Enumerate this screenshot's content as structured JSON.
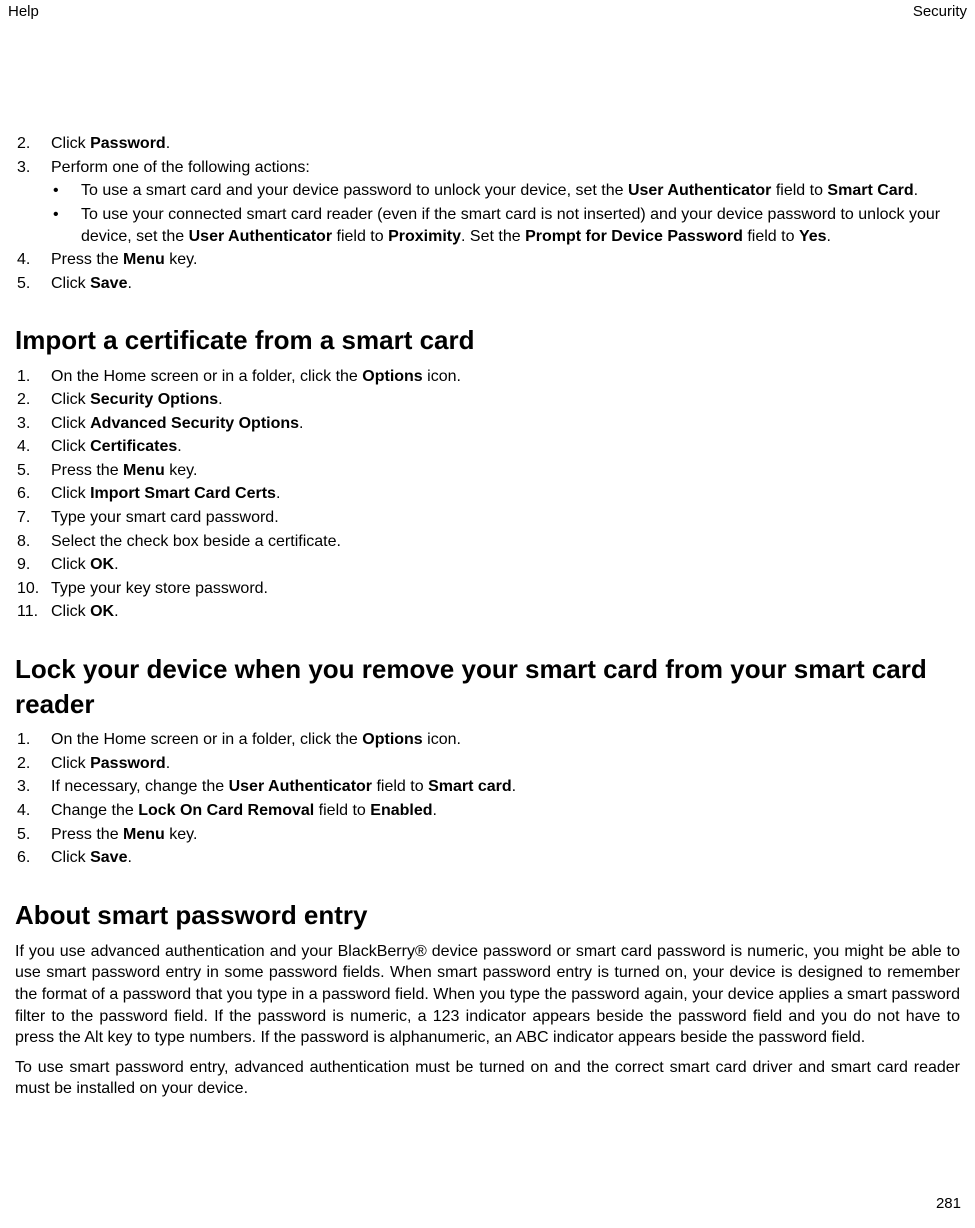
{
  "header": {
    "left": "Help",
    "right": "Security"
  },
  "section0": {
    "steps": [
      {
        "n": "2.",
        "pre": "Click ",
        "b1": "Password",
        "post": "."
      },
      {
        "n": "3.",
        "pre": "Perform one of the following actions:",
        "post": ""
      }
    ],
    "bullets": [
      {
        "pre": "To use a smart card and your device password to unlock your device, set the ",
        "b1": "User Authenticator",
        "mid1": " field to ",
        "b2": "Smart Card",
        "post": "."
      },
      {
        "pre": "To use your connected smart card reader (even if the smart card is not inserted) and your device password to unlock your device, set the ",
        "b1": "User Authenticator",
        "mid1": " field to ",
        "b2": "Proximity",
        "mid2": ". Set the ",
        "b3": "Prompt for Device Password",
        "mid3": " field to ",
        "b4": "Yes",
        "post": "."
      }
    ],
    "steps2": [
      {
        "n": "4.",
        "pre": "Press the ",
        "b1": "Menu",
        "post": " key."
      },
      {
        "n": "5.",
        "pre": "Click ",
        "b1": "Save",
        "post": "."
      }
    ]
  },
  "section1": {
    "title": "Import a certificate from a smart card",
    "steps": [
      {
        "n": "1.",
        "pre": "On the Home screen or in a folder, click the ",
        "b1": "Options",
        "post": " icon."
      },
      {
        "n": "2.",
        "pre": "Click ",
        "b1": "Security Options",
        "post": "."
      },
      {
        "n": "3.",
        "pre": "Click ",
        "b1": "Advanced Security Options",
        "post": "."
      },
      {
        "n": "4.",
        "pre": "Click ",
        "b1": "Certificates",
        "post": "."
      },
      {
        "n": "5.",
        "pre": "Press the ",
        "b1": "Menu",
        "post": " key."
      },
      {
        "n": "6.",
        "pre": "Click ",
        "b1": "Import Smart Card Certs",
        "post": "."
      },
      {
        "n": "7.",
        "pre": "Type your smart card password.",
        "post": ""
      },
      {
        "n": "8.",
        "pre": "Select the check box beside a certificate.",
        "post": ""
      },
      {
        "n": "9.",
        "pre": "Click ",
        "b1": "OK",
        "post": "."
      },
      {
        "n": "10.",
        "pre": "Type your key store password.",
        "post": ""
      },
      {
        "n": "11.",
        "pre": "Click ",
        "b1": "OK",
        "post": "."
      }
    ]
  },
  "section2": {
    "title": "Lock your device when you remove your smart card from your smart card reader",
    "steps": [
      {
        "n": "1.",
        "pre": "On the Home screen or in a folder, click the ",
        "b1": "Options",
        "post": " icon."
      },
      {
        "n": "2.",
        "pre": "Click ",
        "b1": "Password",
        "post": "."
      },
      {
        "n": "3.",
        "pre": "If necessary, change the ",
        "b1": "User Authenticator",
        "mid1": " field to ",
        "b2": "Smart card",
        "post": "."
      },
      {
        "n": "4.",
        "pre": "Change the ",
        "b1": "Lock On Card Removal",
        "mid1": " field to ",
        "b2": "Enabled",
        "post": "."
      },
      {
        "n": "5.",
        "pre": "Press the ",
        "b1": "Menu",
        "post": " key."
      },
      {
        "n": "6.",
        "pre": "Click ",
        "b1": "Save",
        "post": "."
      }
    ]
  },
  "section3": {
    "title": "About smart password entry",
    "p1": "If you use advanced authentication and your BlackBerry® device password or smart card password is numeric, you might be able to use smart password entry in some password fields. When smart password entry is turned on, your device is designed to remember the format of a password that you type in a password field. When you type the password again, your device applies a smart password filter to the password field. If the password is numeric, a 123 indicator appears beside the password field and you do not have to press the Alt key to type numbers. If the password is alphanumeric, an ABC indicator appears beside the password field.",
    "p2": "To use smart password entry, advanced authentication must be turned on and the correct smart card driver and smart card reader must be installed on your device."
  },
  "page_number": "281"
}
